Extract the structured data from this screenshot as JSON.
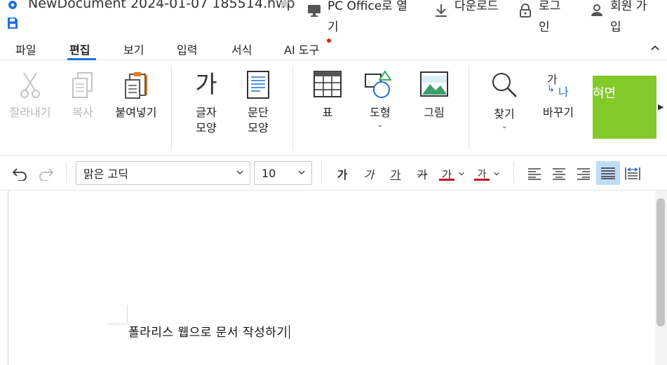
{
  "titlebar": {
    "doc_title": "NewDocument 2024-01-07 185514.hwp",
    "pc_office": "PC Office로 열기",
    "download": "다운로드",
    "login": "로그인",
    "signup": "회원 가입"
  },
  "icons": {
    "app": "app-logo-icon",
    "save": "save-icon",
    "star": "star-icon",
    "pc": "monitor-icon",
    "download": "download-icon",
    "login": "lock-icon",
    "signup": "user-icon",
    "collapse": "chevron-up-icon"
  },
  "menu": {
    "tabs": [
      "파일",
      "편집",
      "보기",
      "입력",
      "서식",
      "AI 도구"
    ],
    "active_tab": "편집"
  },
  "ribbon": {
    "cut": "잘라내기",
    "copy": "복사",
    "paste": "붙여넣기",
    "char_shape": [
      "글자",
      "모양"
    ],
    "para_shape": [
      "문단",
      "모양"
    ],
    "table": "표",
    "shape": "도형",
    "picture": "그림",
    "find": "찾기",
    "replace": "바꾸기",
    "promo": "혀면",
    "char_glyph": "가",
    "replace_glyph_top": "가",
    "replace_glyph_bottom": "나"
  },
  "format": {
    "font_name": "맑은 고딕",
    "font_size": "10",
    "bold_glyph": "가",
    "italic_glyph": "가",
    "underline_glyph": "가",
    "strike_glyph": "가",
    "font_color_glyph": "가",
    "highlight_glyph": "가"
  },
  "document": {
    "text": "폴라리스 웹으로 문서 작성하기"
  },
  "colors": {
    "accent": "#1e6fd9",
    "promo_green": "#84c92a",
    "underline_red": "#c4121c",
    "notification_dot": "#e5191f",
    "active_align": "#bfdcf7"
  }
}
